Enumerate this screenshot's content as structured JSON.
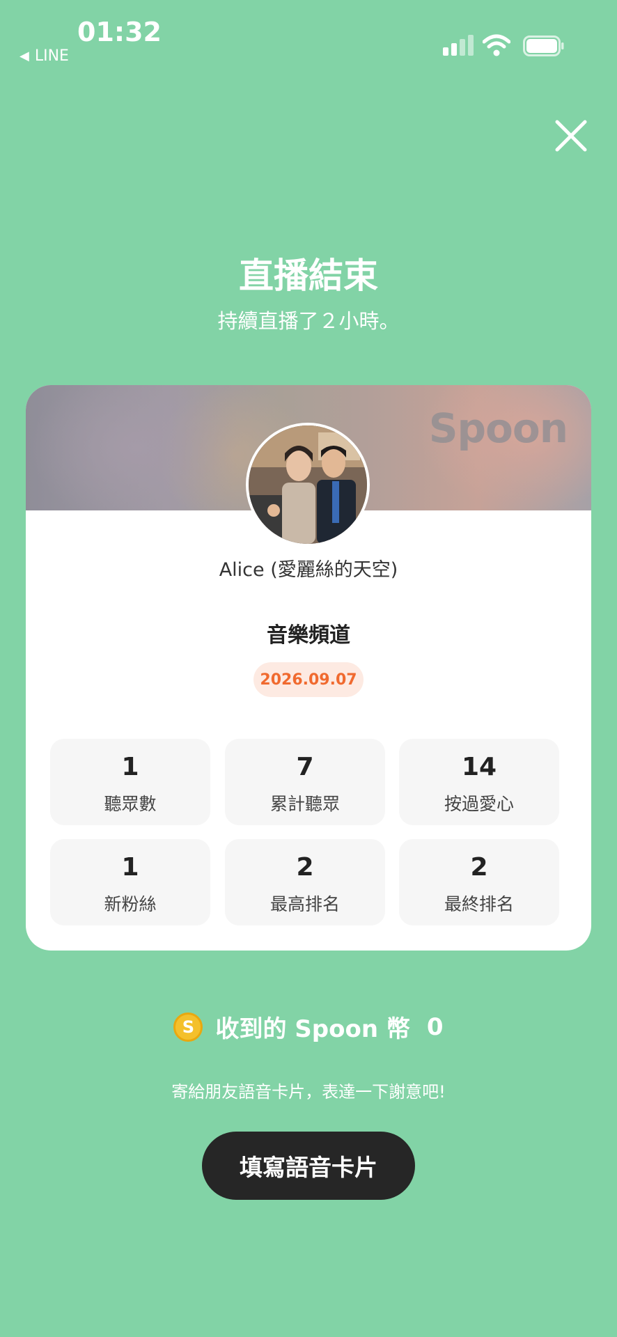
{
  "status_bar": {
    "time": "01:32",
    "back_app": "LINE"
  },
  "header": {
    "title": "直播結束",
    "subtitle": "持續直播了２小時。"
  },
  "card": {
    "brand": "Spoon",
    "host_name": "Alice (愛麗絲的天空)",
    "channel": "音樂頻道",
    "date": "2026.09.07",
    "stats": [
      {
        "value": "1",
        "label": "聽眾數"
      },
      {
        "value": "7",
        "label": "累計聽眾"
      },
      {
        "value": "14",
        "label": "按過愛心"
      },
      {
        "value": "1",
        "label": "新粉絲"
      },
      {
        "value": "2",
        "label": "最高排名"
      },
      {
        "value": "2",
        "label": "最終排名"
      }
    ]
  },
  "coins": {
    "icon": "S",
    "label": "收到的 Spoon 幣",
    "count": "0"
  },
  "footer": {
    "thanks_text": "寄給朋友語音卡片，表達一下謝意吧!",
    "button_label": "填寫語音卡片"
  },
  "colors": {
    "background": "#82d3a6",
    "accent": "#f06a2f",
    "button": "#262626"
  },
  "icons": {
    "close": "close-icon",
    "wifi": "wifi-icon",
    "signal": "signal-icon",
    "battery": "battery-icon"
  }
}
